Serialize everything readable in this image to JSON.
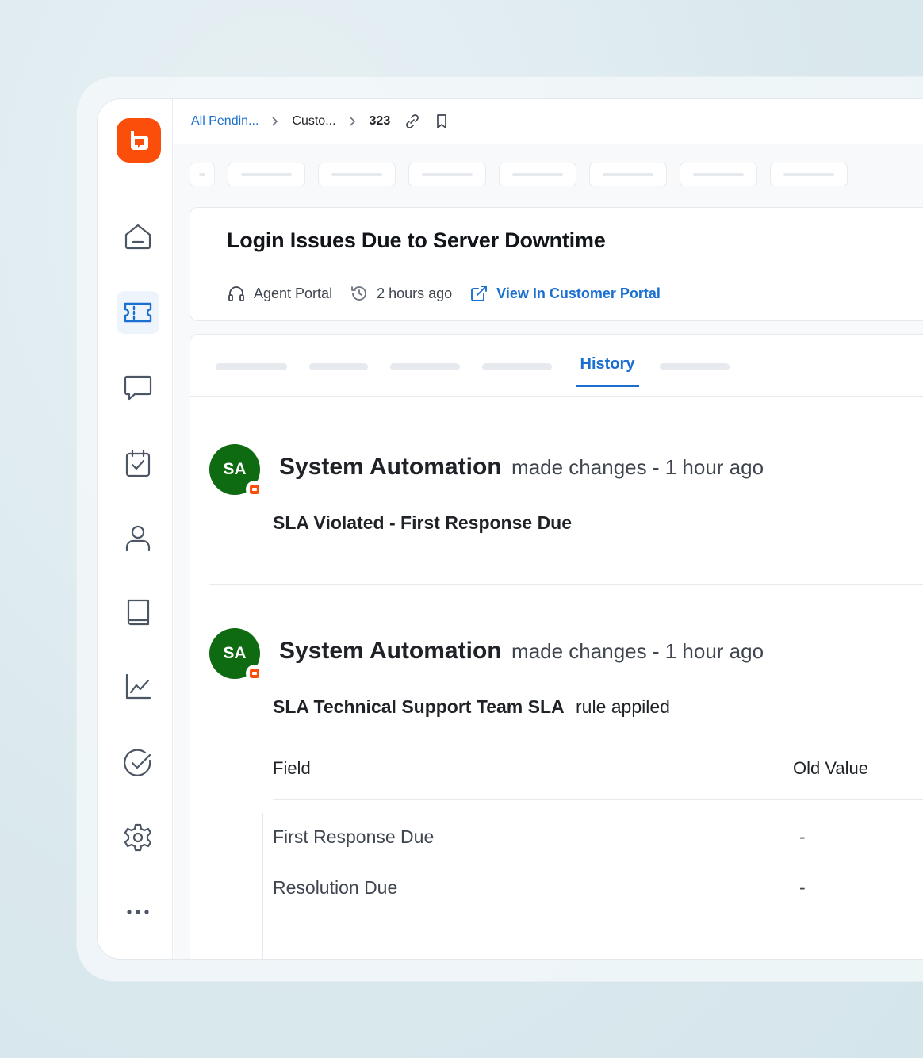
{
  "breadcrumb": {
    "item1": "All Pendin...",
    "item2": "Custo...",
    "ticket_id": "323"
  },
  "ticket": {
    "title": "Login Issues Due to Server Downtime",
    "source": "Agent Portal",
    "time": "2 hours ago",
    "portal_link": "View In Customer Portal"
  },
  "tabs": {
    "active_label": "History"
  },
  "history": [
    {
      "initials": "SA",
      "name": "System Automation",
      "action": "made changes - 1 hour ago",
      "subtitle_bold": "SLA Violated - First Response Due",
      "subtitle_rest": ""
    },
    {
      "initials": "SA",
      "name": "System Automation",
      "action": "made changes - 1 hour ago",
      "subtitle_bold": "SLA Technical Support Team SLA",
      "subtitle_rest": "rule appiled"
    }
  ],
  "changes_table": {
    "headers": [
      "Field",
      "Old Value"
    ],
    "rows": [
      {
        "field": "First Response Due",
        "old": "-"
      },
      {
        "field": "Resolution Due",
        "old": "-"
      }
    ]
  },
  "colors": {
    "brand": "#fa4e0a",
    "accent": "#1a6fd1",
    "avatar": "#0e6b12"
  }
}
